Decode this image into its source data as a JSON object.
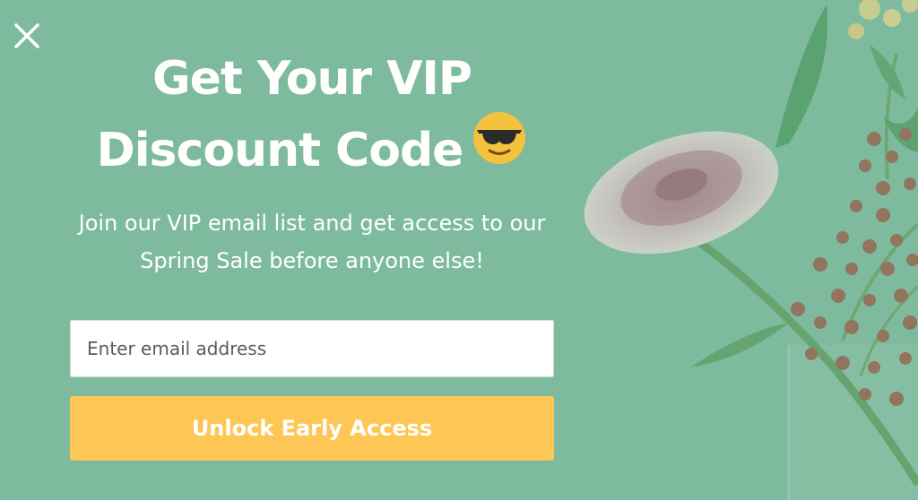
{
  "popup": {
    "title_line1": "Get Your VIP",
    "title_line2": "Discount Code",
    "emoji_icon": "sunglasses-smiley-icon",
    "subtitle_line1": "Join our VIP email list and get access to our",
    "subtitle_line2": "Spring Sale before anyone else!",
    "email_placeholder": "Enter email address",
    "email_value": "",
    "cta_label": "Unlock Early Access",
    "close_icon": "close-icon"
  },
  "colors": {
    "background": "#7fbc9e",
    "button": "#fec654",
    "text": "#ffffff"
  }
}
